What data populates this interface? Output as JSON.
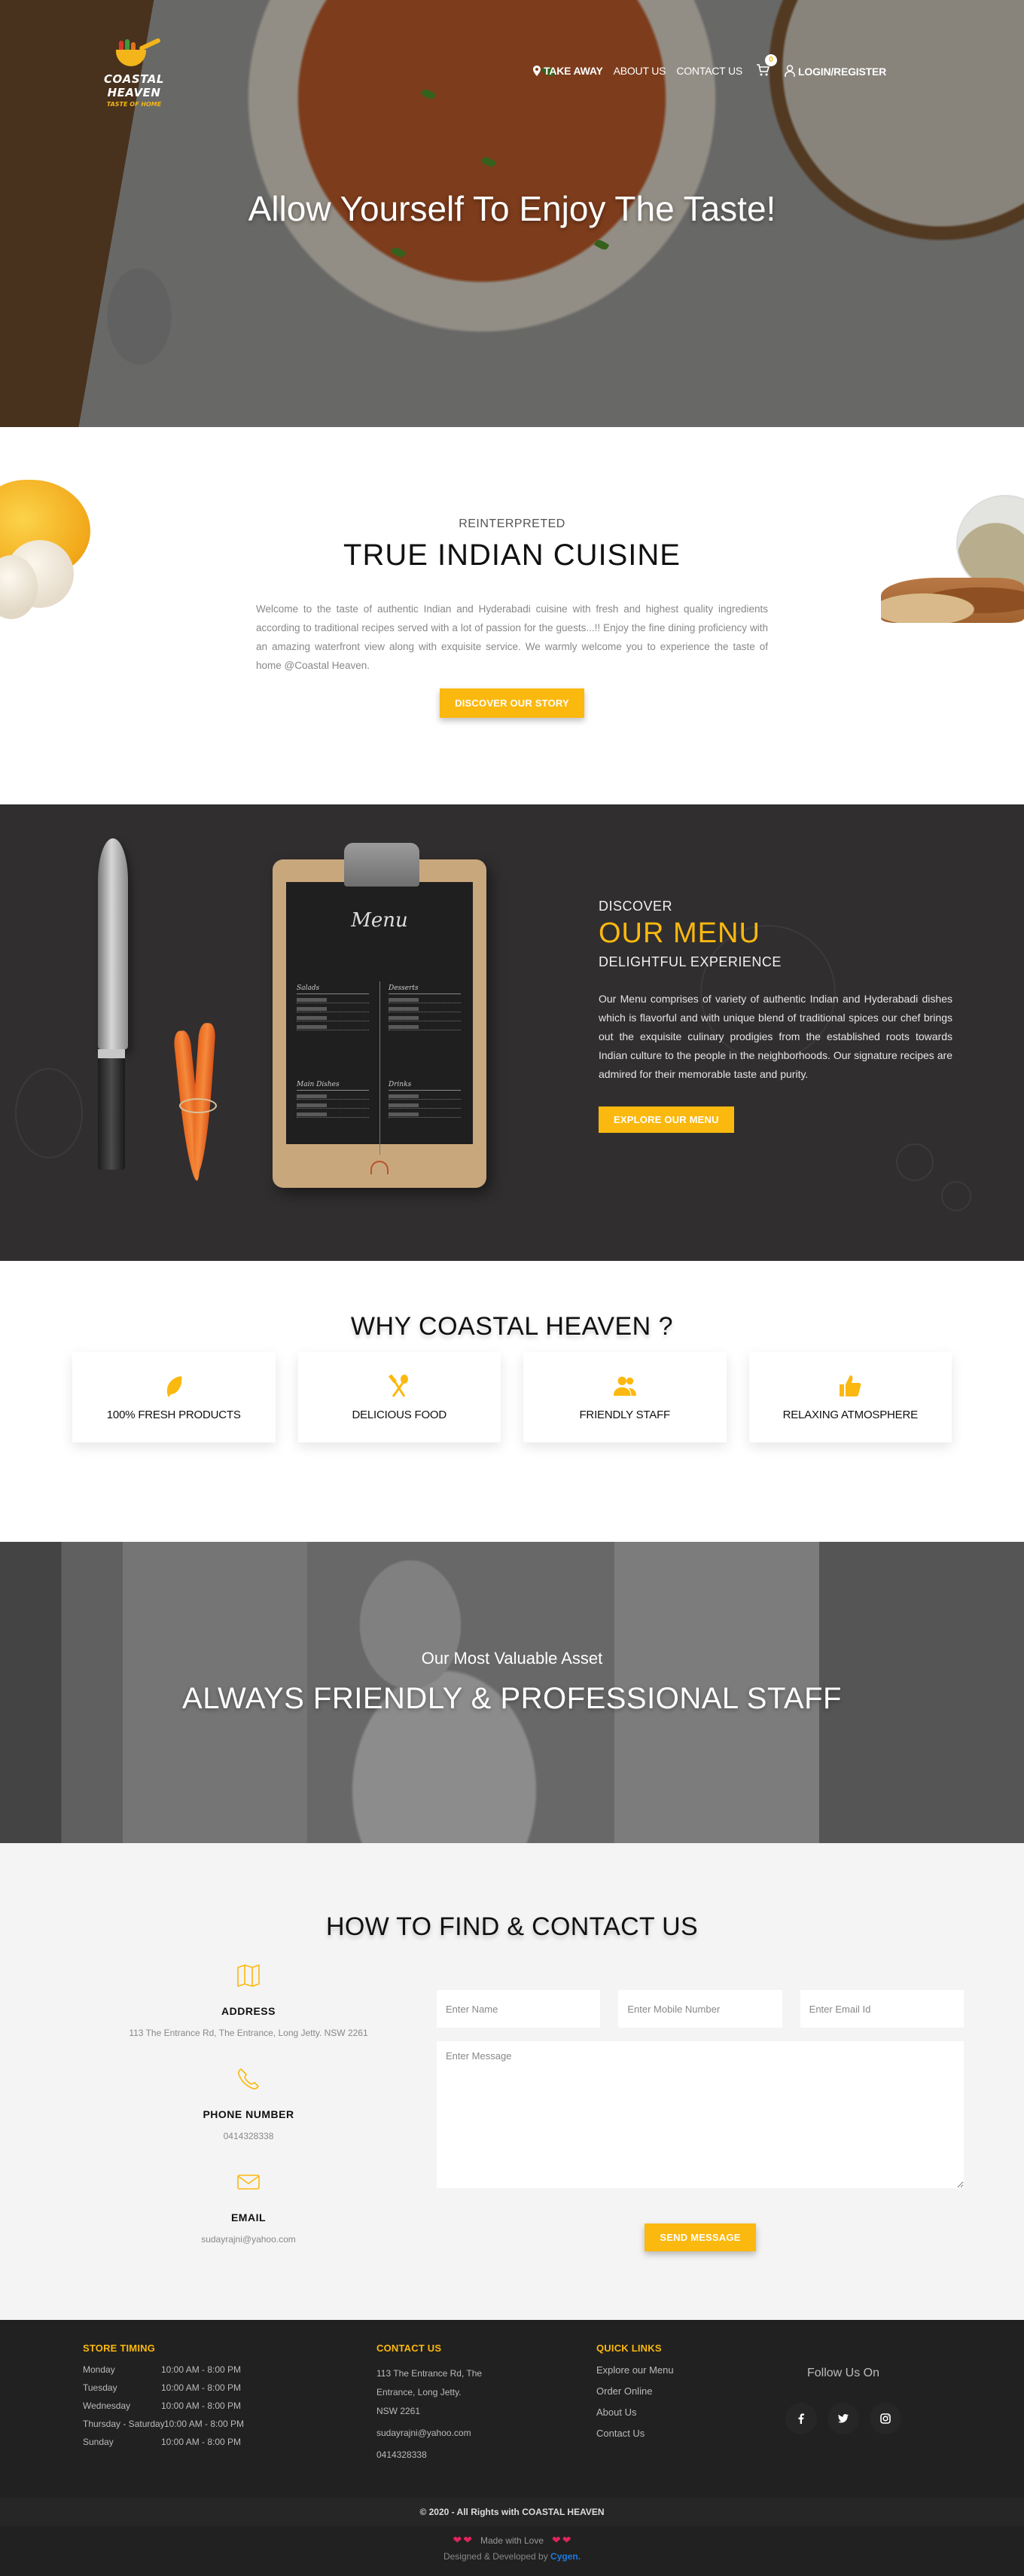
{
  "brand": {
    "name": "COASTAL HEAVEN",
    "tagline": "TASTE OF HOME",
    "accent_color": "#fbb80f"
  },
  "nav": {
    "items": [
      {
        "label": "TAKE AWAY",
        "icon": "map-pin-icon"
      },
      {
        "label": "ABOUT US"
      },
      {
        "label": "CONTACT US"
      }
    ],
    "cart_count": "0",
    "login_label": "LOGIN/REGISTER"
  },
  "hero": {
    "title": "Allow Yourself To Enjoy The Taste!"
  },
  "intro": {
    "eyebrow": "REINTERPRETED",
    "title": "TRUE INDIAN CUISINE",
    "text": "Welcome to the taste of authentic Indian and Hyderabadi cuisine with fresh and highest quality ingredients according to traditional recipes served with a lot of passion for the guests...!! Enjoy the fine dining proficiency with an amazing waterfront view along with exquisite service. We warmly welcome you to experience the taste of home @Coastal Heaven.",
    "button": "DISCOVER OUR STORY"
  },
  "menu": {
    "eyebrow": "DISCOVER",
    "title": "OUR MENU",
    "subtitle": "DELIGHTFUL EXPERIENCE",
    "text": "Our Menu comprises of variety of authentic Indian and Hyderabadi dishes which is flavorful and with unique blend of traditional spices our chef brings out the exquisite culinary prodigies from the established roots towards Indian culture to the people in the neighborhoods. Our signature recipes are admired for their memorable taste and purity.",
    "button": "EXPLORE OUR MENU",
    "board": {
      "title": "Menu",
      "sections": [
        "Salads",
        "Desserts",
        "Main Dishes",
        "Drinks"
      ]
    }
  },
  "why": {
    "title": "WHY COASTAL HEAVEN ?",
    "cards": [
      {
        "label": "100% FRESH PRODUCTS",
        "icon": "leaf-icon"
      },
      {
        "label": "DELICIOUS FOOD",
        "icon": "utensils-icon"
      },
      {
        "label": "FRIENDLY STAFF",
        "icon": "users-icon"
      },
      {
        "label": "RELAXING ATMOSPHERE",
        "icon": "thumbs-up-icon"
      }
    ]
  },
  "staff": {
    "eyebrow": "Our Most Valuable Asset",
    "title": "ALWAYS FRIENDLY & PROFESSIONAL STAFF"
  },
  "contact": {
    "title": "HOW TO FIND & CONTACT US",
    "info": [
      {
        "label": "ADDRESS",
        "value": "113 The Entrance Rd, The Entrance, Long Jetty. NSW 2261",
        "icon": "map-icon"
      },
      {
        "label": "PHONE NUMBER",
        "value": "0414328338",
        "icon": "phone-icon"
      },
      {
        "label": "EMAIL",
        "value": "sudayrajni@yahoo.com",
        "icon": "mail-icon"
      }
    ],
    "form": {
      "name_placeholder": "Enter Name",
      "mobile_placeholder": "Enter Mobile Number",
      "email_placeholder": "Enter Email Id",
      "message_placeholder": "Enter Message",
      "name_value": "",
      "mobile_value": "",
      "email_value": "",
      "message_value": "",
      "submit": "SEND MESSAGE"
    }
  },
  "footer": {
    "timing": {
      "heading": "STORE TIMING",
      "rows": [
        {
          "day": "Monday",
          "hours": "10:00 AM - 8:00 PM"
        },
        {
          "day": "Tuesday",
          "hours": "10:00 AM - 8:00 PM"
        },
        {
          "day": "Wednesday",
          "hours": "10:00 AM - 8:00 PM"
        },
        {
          "day": "Thursday - Saturday",
          "hours": "10:00 AM - 8:00 PM"
        },
        {
          "day": "Sunday",
          "hours": "10:00 AM - 8:00 PM"
        }
      ]
    },
    "contact": {
      "heading": "CONTACT US",
      "address_lines": [
        "113 The Entrance Rd, The",
        "Entrance, Long Jetty.",
        "NSW 2261"
      ],
      "email": "sudayrajni@yahoo.com",
      "phone": "0414328338"
    },
    "quick_links": {
      "heading": "QUICK LINKS",
      "items": [
        "Explore our Menu",
        "Order Online",
        "About Us",
        "Contact Us"
      ]
    },
    "follow": {
      "title": "Follow Us On",
      "socials": [
        {
          "name": "facebook",
          "glyph": "f"
        },
        {
          "name": "twitter",
          "glyph": "t"
        },
        {
          "name": "instagram",
          "glyph": "ig"
        }
      ]
    },
    "copyright": "© 2020 - All Rights with COASTAL HEAVEN",
    "made_with": "Made with Love",
    "designed_by_prefix": "Designed & Developed by",
    "designed_by_brand": "Cygen."
  }
}
